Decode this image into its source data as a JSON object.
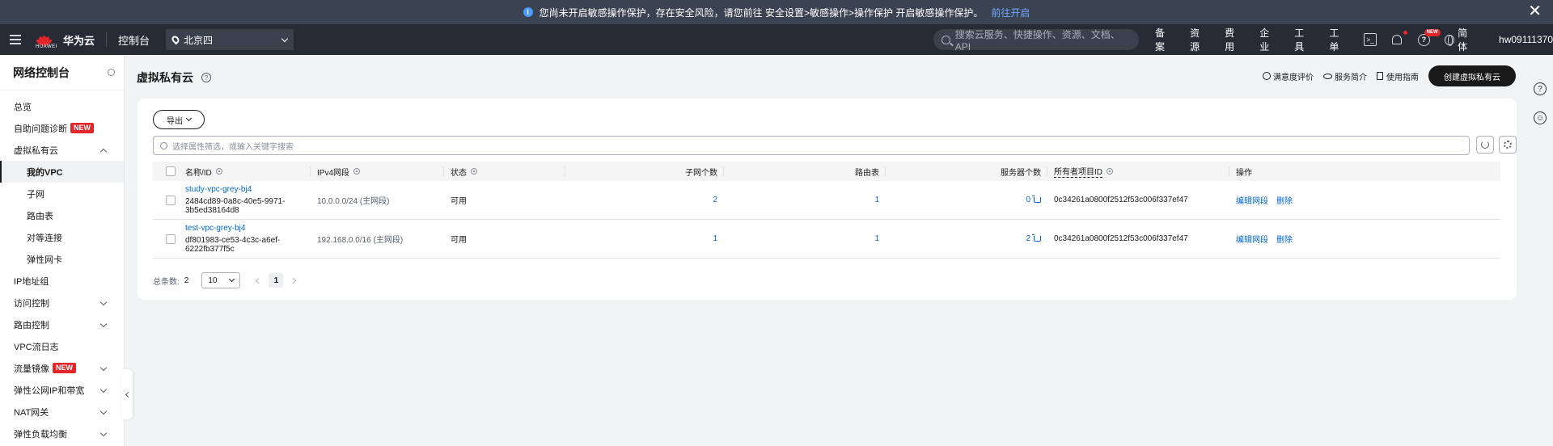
{
  "notice": {
    "message": "您尚未开启敏感操作保护，存在安全风险，请您前往 安全设置>敏感操作>操作保护 开启敏感操作保护。",
    "link": "前往开启"
  },
  "header": {
    "brand_caption": "HUAWEI",
    "brand": "华为云",
    "console": "控制台",
    "region": "北京四",
    "search_placeholder": "搜索云服务、快捷操作、资源、文档、API",
    "nav": [
      "备案",
      "资源",
      "费用",
      "企业",
      "工具",
      "工单"
    ],
    "new_pill": "NEW",
    "language": "简体",
    "username": "hw09111370"
  },
  "sidebar": {
    "title": "网络控制台",
    "new_badge": "NEW",
    "items": [
      {
        "label": "总览"
      },
      {
        "label": "自助问题诊断"
      },
      {
        "label": "虚拟私有云"
      },
      {
        "label": "我的VPC"
      },
      {
        "label": "子网"
      },
      {
        "label": "路由表"
      },
      {
        "label": "对等连接"
      },
      {
        "label": "弹性网卡"
      },
      {
        "label": "IP地址组"
      },
      {
        "label": "访问控制"
      },
      {
        "label": "路由控制"
      },
      {
        "label": "VPC流日志"
      },
      {
        "label": "流量镜像"
      },
      {
        "label": "弹性公网IP和带宽"
      },
      {
        "label": "NAT网关"
      },
      {
        "label": "弹性负载均衡"
      }
    ]
  },
  "page": {
    "title": "虚拟私有云",
    "actions": [
      "满意度评价",
      "服务简介",
      "使用指南"
    ],
    "create_button": "创建虚拟私有云"
  },
  "toolbar": {
    "export": "导出",
    "filter_placeholder": "选择属性筛选，或输入关键字搜索"
  },
  "table": {
    "columns": [
      "名称/ID",
      "IPv4网段",
      "状态",
      "子网个数",
      "路由表",
      "服务器个数",
      "所有者项目ID",
      "操作"
    ],
    "rows": [
      {
        "name": "study-vpc-grey-bj4",
        "id": "2484cd89-0a8c-40e5-9971-3b5ed38164d8",
        "cidr": "10.0.0.0/24 (主网段)",
        "status": "可用",
        "subnets": "2",
        "route_tables": "1",
        "servers": "0",
        "owner_project_id": "0c34261a0800f2512f53c006f337ef47",
        "op_edit": "编辑网段",
        "op_delete": "删除"
      },
      {
        "name": "test-vpc-grey-bj4",
        "id": "df801983-ce53-4c3c-a6ef-6222fb377f5c",
        "cidr": "192.168.0.0/16 (主网段)",
        "status": "可用",
        "subnets": "1",
        "route_tables": "1",
        "servers": "2",
        "owner_project_id": "0c34261a0800f2512f53c006f337ef47",
        "op_edit": "编辑网段",
        "op_delete": "删除"
      }
    ]
  },
  "pagination": {
    "total_label": "总条数:",
    "total": "2",
    "page_size": "10",
    "current_page": "1"
  }
}
